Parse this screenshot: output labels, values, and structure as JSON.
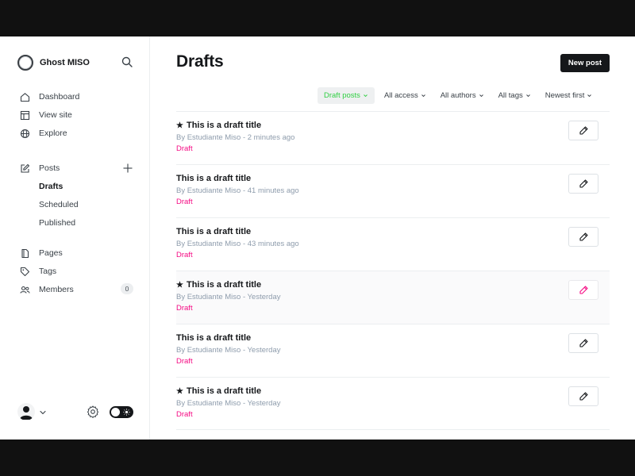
{
  "brand": {
    "name": "Ghost MISO"
  },
  "nav": {
    "dashboard": "Dashboard",
    "view_site": "View site",
    "explore": "Explore",
    "posts": "Posts",
    "drafts": "Drafts",
    "scheduled": "Scheduled",
    "published": "Published",
    "pages": "Pages",
    "tags": "Tags",
    "members": "Members",
    "members_count": "0"
  },
  "header": {
    "title": "Drafts",
    "new_post": "New post"
  },
  "filters": {
    "type": "Draft posts",
    "access": "All access",
    "authors": "All authors",
    "tags": "All tags",
    "order": "Newest first"
  },
  "posts": [
    {
      "title": "This is a draft title",
      "featured": true,
      "meta": "By Estudiante Miso - 2 minutes ago",
      "status": "Draft"
    },
    {
      "title": "This is a draft title",
      "featured": false,
      "meta": "By Estudiante Miso - 41 minutes ago",
      "status": "Draft"
    },
    {
      "title": "This is a draft title",
      "featured": false,
      "meta": "By Estudiante Miso - 43 minutes ago",
      "status": "Draft"
    },
    {
      "title": "This is a draft title",
      "featured": true,
      "meta": "By Estudiante Miso - Yesterday",
      "status": "Draft"
    },
    {
      "title": "This is a draft title",
      "featured": false,
      "meta": "By Estudiante Miso - Yesterday",
      "status": "Draft"
    },
    {
      "title": "This is a draft title",
      "featured": true,
      "meta": "By Estudiante Miso - Yesterday",
      "status": "Draft"
    }
  ],
  "icons": {
    "star": "★"
  },
  "colors": {
    "accent_green": "#30cf43",
    "status_pink": "#f50b84",
    "primary_dark": "#15171a",
    "muted_text": "#8e9cac"
  }
}
